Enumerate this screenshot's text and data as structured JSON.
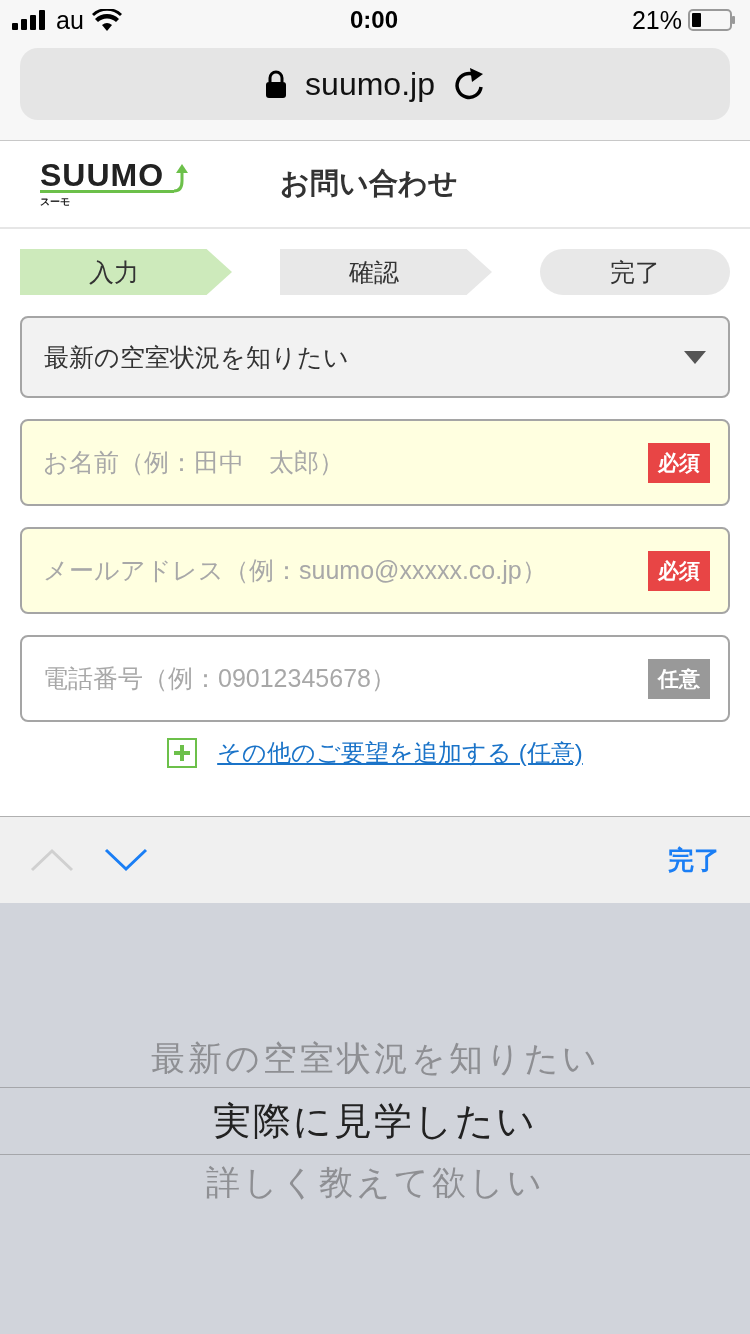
{
  "status_bar": {
    "carrier": "au",
    "time": "0:00",
    "battery": "21%"
  },
  "browser": {
    "url": "suumo.jp"
  },
  "header": {
    "logo_text": "SUUMO",
    "logo_sub": "スーモ",
    "title": "お問い合わせ"
  },
  "steps": [
    {
      "label": "入力",
      "kind": "arrow",
      "selected": true
    },
    {
      "label": "確認",
      "kind": "arrow",
      "selected": false
    },
    {
      "label": "完了",
      "kind": "pill",
      "selected": false
    }
  ],
  "inquiry_select": {
    "value": "最新の空室状況を知りたい"
  },
  "fields": [
    {
      "placeholder": "お名前（例：田中　太郎）",
      "badge": "必須",
      "required": true
    },
    {
      "placeholder": "メールアドレス（例：suumo@xxxxx.co.jp）",
      "badge": "必須",
      "required": true
    },
    {
      "placeholder": "電話番号（例：09012345678）",
      "badge": "任意",
      "required": false
    }
  ],
  "add_request_link": "その他のご要望を追加する (任意)",
  "keyboard_toolbar": {
    "previous_disabled": true,
    "next_disabled": false,
    "done": "完了"
  },
  "picker": {
    "options": [
      {
        "label": "最新の空室状況を知りたい",
        "selected": false
      },
      {
        "label": "実際に見学したい",
        "selected": true
      },
      {
        "label": "詳しく教えて欲しい",
        "selected": false
      }
    ]
  }
}
